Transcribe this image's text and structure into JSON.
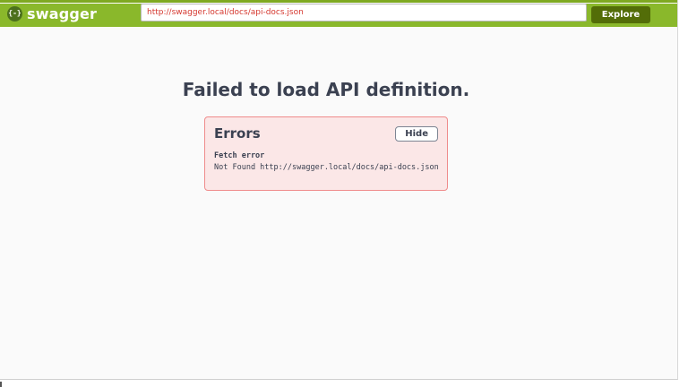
{
  "topbar": {
    "logo": {
      "icon": "swagger-logo",
      "glyph": "{-}",
      "title": "swagger"
    },
    "url_input": {
      "value": "http://swagger.local/docs/api-docs.json"
    },
    "explore_button_label": "Explore",
    "colors": {
      "bar_green": "#8ab82b",
      "explore_button_green": "#536d08",
      "url_text_red": "#d5382f"
    }
  },
  "main": {
    "heading": "Failed to load API definition.",
    "errors_panel": {
      "title": "Errors",
      "hide_button_label": "Hide",
      "items": [
        {
          "type": "Fetch error",
          "message": "Not Found http://swagger.local/docs/api-docs.json"
        }
      ],
      "colors": {
        "background": "#fbe7e7",
        "border": "#ef8c8c",
        "text": "#3b4151"
      }
    },
    "background_color": "#fafafa"
  }
}
